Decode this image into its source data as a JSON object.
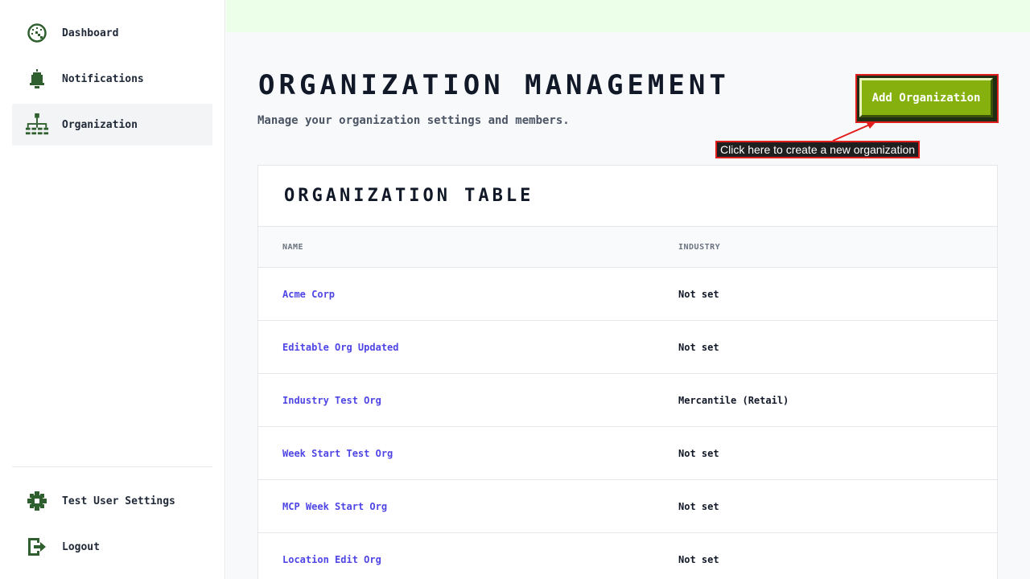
{
  "sidebar": {
    "top_items": [
      {
        "label": "Dashboard",
        "icon": "dashboard-icon",
        "active": false
      },
      {
        "label": "Notifications",
        "icon": "bell-icon",
        "active": false
      },
      {
        "label": "Organization",
        "icon": "org-chart-icon",
        "active": true
      }
    ],
    "bottom_items": [
      {
        "label": "Test User Settings",
        "icon": "gear-icon"
      },
      {
        "label": "Logout",
        "icon": "logout-icon"
      }
    ]
  },
  "header": {
    "title": "Organization Management",
    "subtitle": "Manage your organization settings and members.",
    "add_button_label": "Add Organization",
    "tooltip": "Click here to create a new organization"
  },
  "table": {
    "title": "Organization Table",
    "columns": [
      "Name",
      "Industry"
    ],
    "rows": [
      {
        "name": "Acme Corp",
        "industry": "Not set"
      },
      {
        "name": "Editable Org Updated",
        "industry": "Not set"
      },
      {
        "name": "Industry Test Org",
        "industry": "Mercantile (Retail)"
      },
      {
        "name": "Week Start Test Org",
        "industry": "Not set"
      },
      {
        "name": "MCP Week Start Org",
        "industry": "Not set"
      },
      {
        "name": "Location Edit Org",
        "industry": "Not set"
      }
    ]
  },
  "colors": {
    "accent_green": "#86b00e",
    "icon_green": "#2f5f2f",
    "link_indigo": "#4f46e5",
    "annotation_red": "#e11d1d",
    "banner_green": "#ecffe8"
  }
}
